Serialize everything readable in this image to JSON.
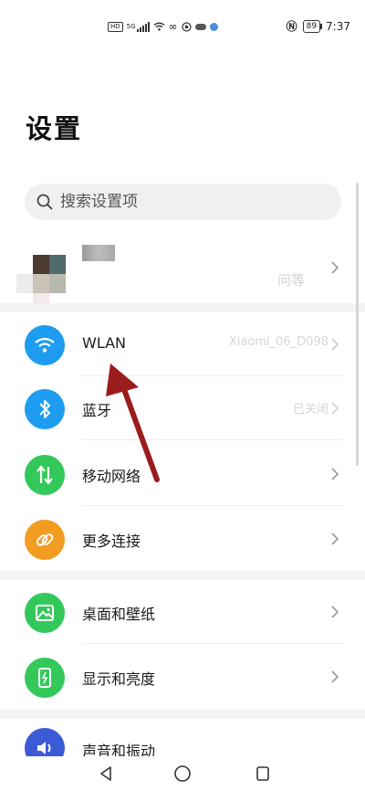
{
  "status_bar": {
    "hd": "HD",
    "network": "5G",
    "battery": "89",
    "time": "7:37",
    "icons": [
      "hd-icon",
      "signal-icon",
      "wifi-icon",
      "infinity-icon",
      "camera-icon",
      "cloud-icon",
      "app-dot-icon",
      "nfc-icon",
      "battery-icon"
    ]
  },
  "page": {
    "title": "设置"
  },
  "search": {
    "placeholder": "搜索设置项"
  },
  "profile": {
    "subtitle": "问等"
  },
  "connectivity": [
    {
      "label": "WLAN",
      "value": "Xiaomi_06_D098",
      "icon": "wifi-icon",
      "color": "#1e9cf0"
    },
    {
      "label": "蓝牙",
      "value": "已关闭",
      "icon": "bluetooth-icon",
      "color": "#1e9cf0"
    },
    {
      "label": "移动网络",
      "value": "",
      "icon": "mobile-data-icon",
      "color": "#33c85a"
    },
    {
      "label": "更多连接",
      "value": "",
      "icon": "link-icon",
      "color": "#f39c22"
    }
  ],
  "display": [
    {
      "label": "桌面和壁纸",
      "icon": "wallpaper-icon",
      "color": "#33c85a"
    },
    {
      "label": "显示和亮度",
      "icon": "brightness-icon",
      "color": "#33c85a"
    }
  ],
  "sound": {
    "label": "声音和振动",
    "icon": "sound-icon",
    "color": "#3b5bd6"
  },
  "annotation": {
    "color": "#9b1c1c",
    "icon": "red-arrow-annotation"
  },
  "navigation": [
    "back-icon",
    "home-icon",
    "recents-icon"
  ]
}
